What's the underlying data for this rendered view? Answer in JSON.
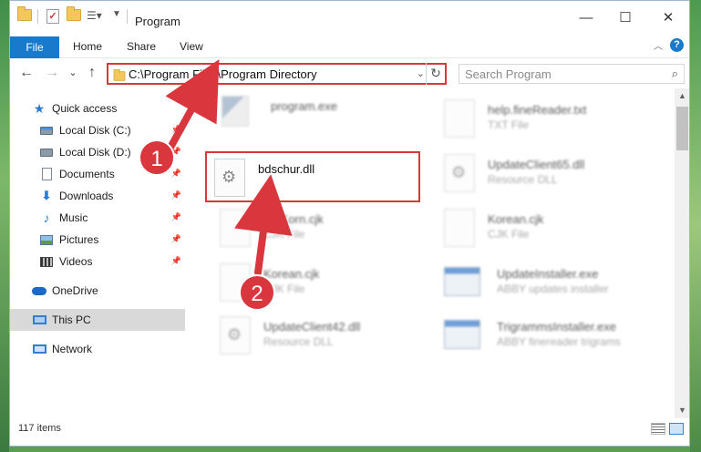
{
  "window": {
    "title": "Program",
    "minimize": "—",
    "maximize": "☐",
    "close": "✕"
  },
  "ribbon": {
    "tabs": [
      "File",
      "Home",
      "Share",
      "View"
    ],
    "help": "?"
  },
  "address": {
    "path": "C:\\Program Files\\Program Directory",
    "search_placeholder": "Search Program"
  },
  "nav": {
    "back": "←",
    "forward": "→",
    "history": "⌄",
    "up": "↑"
  },
  "sidebar": {
    "items": [
      {
        "label": "Quick access",
        "icon": "star-icon"
      },
      {
        "label": "Local Disk (C:)",
        "icon": "disk-icon",
        "pinned": true
      },
      {
        "label": "Local Disk (D:)",
        "icon": "disk-icon",
        "pinned": true
      },
      {
        "label": "Documents",
        "icon": "document-icon",
        "pinned": true
      },
      {
        "label": "Downloads",
        "icon": "download-icon",
        "pinned": true
      },
      {
        "label": "Music",
        "icon": "music-icon",
        "pinned": true
      },
      {
        "label": "Pictures",
        "icon": "pictures-icon",
        "pinned": true
      },
      {
        "label": "Videos",
        "icon": "videos-icon",
        "pinned": true
      },
      {
        "label": "OneDrive",
        "icon": "cloud-icon"
      },
      {
        "label": "This PC",
        "icon": "computer-icon",
        "selected": true
      },
      {
        "label": "Network",
        "icon": "network-icon"
      }
    ]
  },
  "files": {
    "left": [
      {
        "name": "program.exe",
        "sub": ""
      },
      {
        "name": "bdschur.dll",
        "sub": ""
      },
      {
        "name": "BGKorn.cjk",
        "sub": "CJK File"
      },
      {
        "name": "Korean.cjk",
        "sub": "CJK File"
      },
      {
        "name": "UpdateClient42.dll",
        "sub": "Resource DLL"
      }
    ],
    "right": [
      {
        "name": "help.fineReader.txt",
        "sub": "TXT File"
      },
      {
        "name": "UpdateClient65.dll",
        "sub": "Resource DLL"
      },
      {
        "name": "Korean.cjk",
        "sub": "CJK File"
      },
      {
        "name": "UpdateInstaller.exe",
        "sub": "ABBY updates installer"
      },
      {
        "name": "TrigrammsInstaller.exe",
        "sub": "ABBY finereader trigrams"
      }
    ]
  },
  "status": {
    "items_count": "117 items"
  },
  "callouts": {
    "one": "1",
    "two": "2"
  },
  "colors": {
    "accent": "#1979ca",
    "highlight": "#d9363e"
  }
}
